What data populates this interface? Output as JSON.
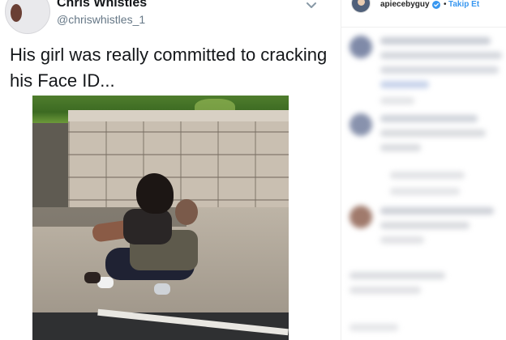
{
  "tweet": {
    "name": "Chris Whistles",
    "handle": "@chriswhistles_1",
    "text": "His girl was really committed to cracking his Face ID...",
    "icons": {
      "menu": "chevron-down-icon",
      "avatar": "avatar"
    }
  },
  "instagram": {
    "username": "apiecebyguy",
    "verified": true,
    "separator": "•",
    "follow_label": "Takip Et",
    "colors": {
      "follow": "#3897f0",
      "verified": "#3897f0",
      "text": "#262626"
    }
  }
}
